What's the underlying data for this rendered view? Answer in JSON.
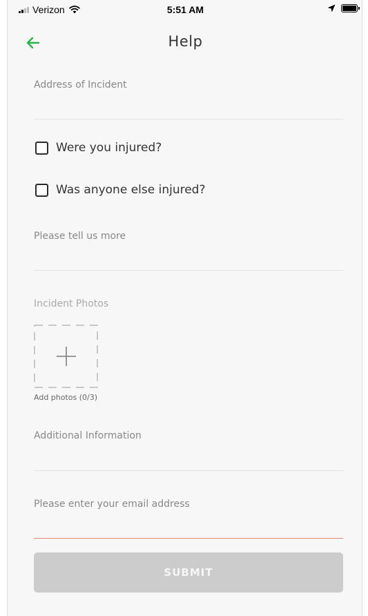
{
  "status_bar": {
    "carrier": "Verizon",
    "time": "5:51 AM",
    "icons": [
      "signal-icon",
      "wifi-icon",
      "location-arrow-icon",
      "battery-icon"
    ]
  },
  "nav": {
    "title": "Help",
    "back_icon": "arrow-left-icon",
    "accent_color": "#2bb34a"
  },
  "form": {
    "address": {
      "placeholder": "Address of Incident",
      "value": ""
    },
    "injured_self": {
      "label": "Were you injured?",
      "checked": false
    },
    "injured_other": {
      "label": "Was anyone else injured?",
      "checked": false
    },
    "more_info": {
      "placeholder": "Please tell us more",
      "value": ""
    },
    "photos": {
      "label": "Incident Photos",
      "add_caption": "Add photos (0/3)",
      "count": 0,
      "max": 3,
      "add_icon": "plus-icon"
    },
    "additional": {
      "placeholder": "Additional Information",
      "value": ""
    },
    "email": {
      "placeholder": "Please enter your email address",
      "value": "",
      "error_color": "#e8857a"
    },
    "submit_label": "SUBMIT"
  },
  "colors": {
    "background": "#f7f7f7",
    "submit_disabled": "#cccccc"
  }
}
